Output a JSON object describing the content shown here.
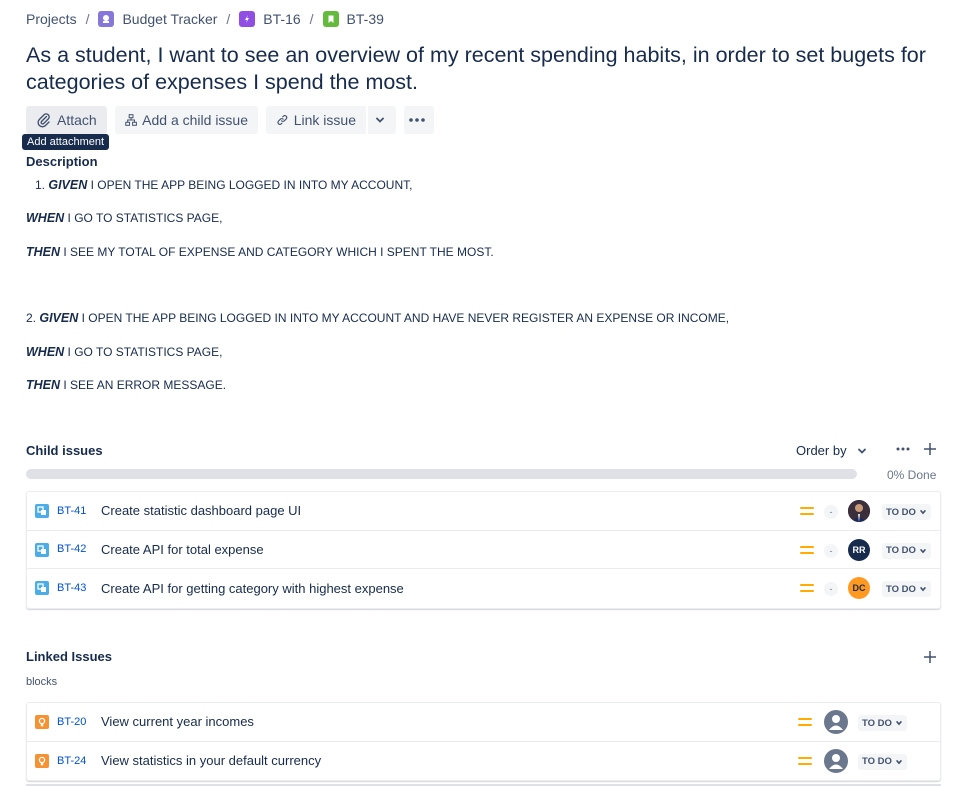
{
  "breadcrumb": {
    "projects": "Projects",
    "project": "Budget Tracker",
    "epic": "BT-16",
    "issue": "BT-39",
    "separator": "/"
  },
  "issue": {
    "title": "As a student, I want to see an overview of my recent spending habits, in order to set bugets for categories of expenses I spend the most."
  },
  "toolbar": {
    "attach_label": "Attach",
    "add_child_label": "Add a child issue",
    "link_issue_label": "Link issue",
    "tooltip": "Add attachment"
  },
  "description": {
    "label": "Description",
    "scenario1": {
      "number": "1.",
      "given_kw": "GIVEN",
      "given": " I OPEN THE APP BEING LOGGED IN INTO MY ACCOUNT,",
      "when_kw": "WHEN",
      "when": " I GO TO STATISTICS PAGE,",
      "then_kw": "THEN",
      "then": " I SEE MY TOTAL OF EXPENSE AND CATEGORY WHICH I SPENT THE MOST."
    },
    "scenario2": {
      "number": "2.",
      "given_kw": "GIVEN",
      "given": " I OPEN THE APP BEING LOGGED IN INTO MY ACCOUNT AND HAVE NEVER REGISTER AN EXPENSE OR INCOME,",
      "when_kw": "WHEN",
      "when": " I GO TO STATISTICS PAGE,",
      "then_kw": "THEN",
      "then": " I SEE AN ERROR MESSAGE."
    }
  },
  "child_issues": {
    "title": "Child issues",
    "order_by": "Order by",
    "progress_done_fraction": 0,
    "done_text": "0% Done",
    "items": [
      {
        "key": "BT-41",
        "summary": "Create statistic dashboard page UI",
        "estimate": "-",
        "assignee": "",
        "status": "TO DO"
      },
      {
        "key": "BT-42",
        "summary": "Create API for total expense",
        "estimate": "-",
        "assignee": "RR",
        "status": "TO DO"
      },
      {
        "key": "BT-43",
        "summary": "Create API for getting category with highest expense",
        "estimate": "-",
        "assignee": "DC",
        "status": "TO DO"
      }
    ]
  },
  "linked_issues": {
    "title": "Linked Issues",
    "relation": "blocks",
    "items": [
      {
        "key": "BT-20",
        "summary": "View current year incomes",
        "status": "TO DO"
      },
      {
        "key": "BT-24",
        "summary": "View statistics in your default currency",
        "status": "TO DO"
      }
    ]
  },
  "colors": {
    "link": "#0052cc",
    "priority_medium": "#ffab00",
    "avatar_rr": "#172b4d",
    "avatar_dc": "#ff991f",
    "subtask": "#4bade8",
    "bug": "#f79233"
  }
}
